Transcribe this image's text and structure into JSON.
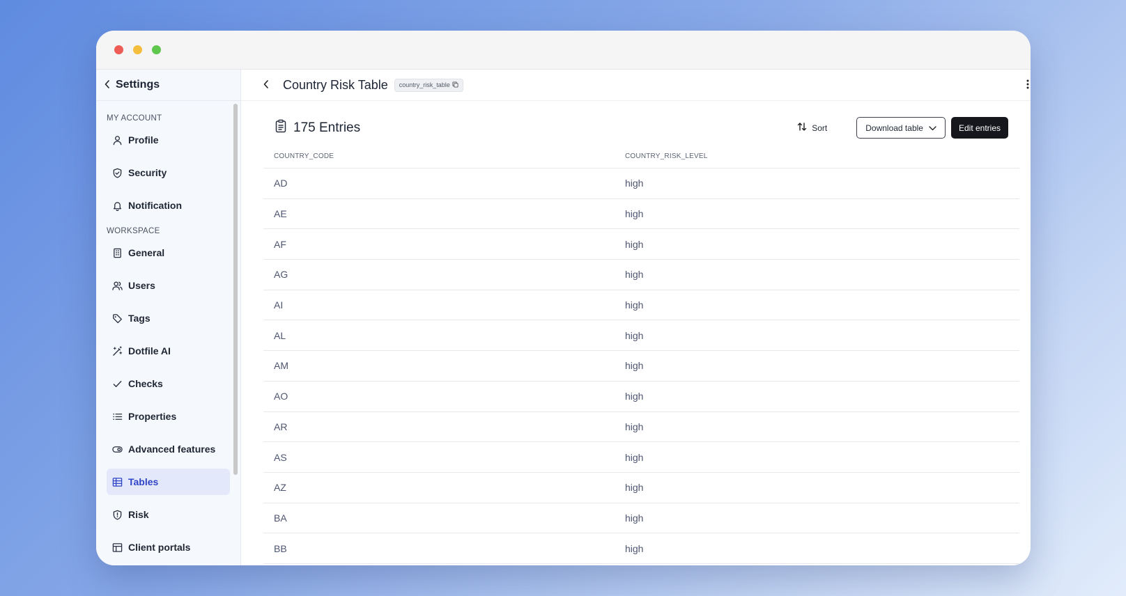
{
  "sidebar": {
    "back_label": "Settings",
    "sections": [
      {
        "label": "MY ACCOUNT",
        "items": [
          {
            "label": "Profile",
            "icon": "user-icon"
          },
          {
            "label": "Security",
            "icon": "shield-check-icon"
          },
          {
            "label": "Notification",
            "icon": "bell-icon"
          }
        ]
      },
      {
        "label": "WORKSPACE",
        "items": [
          {
            "label": "General",
            "icon": "building-icon"
          },
          {
            "label": "Users",
            "icon": "users-icon"
          },
          {
            "label": "Tags",
            "icon": "tag-icon"
          },
          {
            "label": "Dotfile AI",
            "icon": "magic-wand-icon"
          },
          {
            "label": "Checks",
            "icon": "check-icon"
          },
          {
            "label": "Properties",
            "icon": "list-icon"
          },
          {
            "label": "Advanced features",
            "icon": "toggle-icon"
          },
          {
            "label": "Tables",
            "icon": "table-icon",
            "active": true
          },
          {
            "label": "Risk",
            "icon": "shield-alert-icon"
          },
          {
            "label": "Client portals",
            "icon": "layout-icon"
          }
        ]
      }
    ]
  },
  "header": {
    "title": "Country Risk Table",
    "slug": "country_risk_table"
  },
  "toolbar": {
    "entries_label": "175 Entries",
    "sort_label": "Sort",
    "download_label": "Download table",
    "edit_label": "Edit entries"
  },
  "table": {
    "columns": [
      "COUNTRY_CODE",
      "COUNTRY_RISK_LEVEL"
    ],
    "rows": [
      [
        "AD",
        "high"
      ],
      [
        "AE",
        "high"
      ],
      [
        "AF",
        "high"
      ],
      [
        "AG",
        "high"
      ],
      [
        "AI",
        "high"
      ],
      [
        "AL",
        "high"
      ],
      [
        "AM",
        "high"
      ],
      [
        "AO",
        "high"
      ],
      [
        "AR",
        "high"
      ],
      [
        "AS",
        "high"
      ],
      [
        "AZ",
        "high"
      ],
      [
        "BA",
        "high"
      ],
      [
        "BB",
        "high"
      ]
    ]
  },
  "colors": {
    "accent": "#2f44c7",
    "active_bg": "#e3e9fb",
    "primary_button": "#15171c"
  }
}
